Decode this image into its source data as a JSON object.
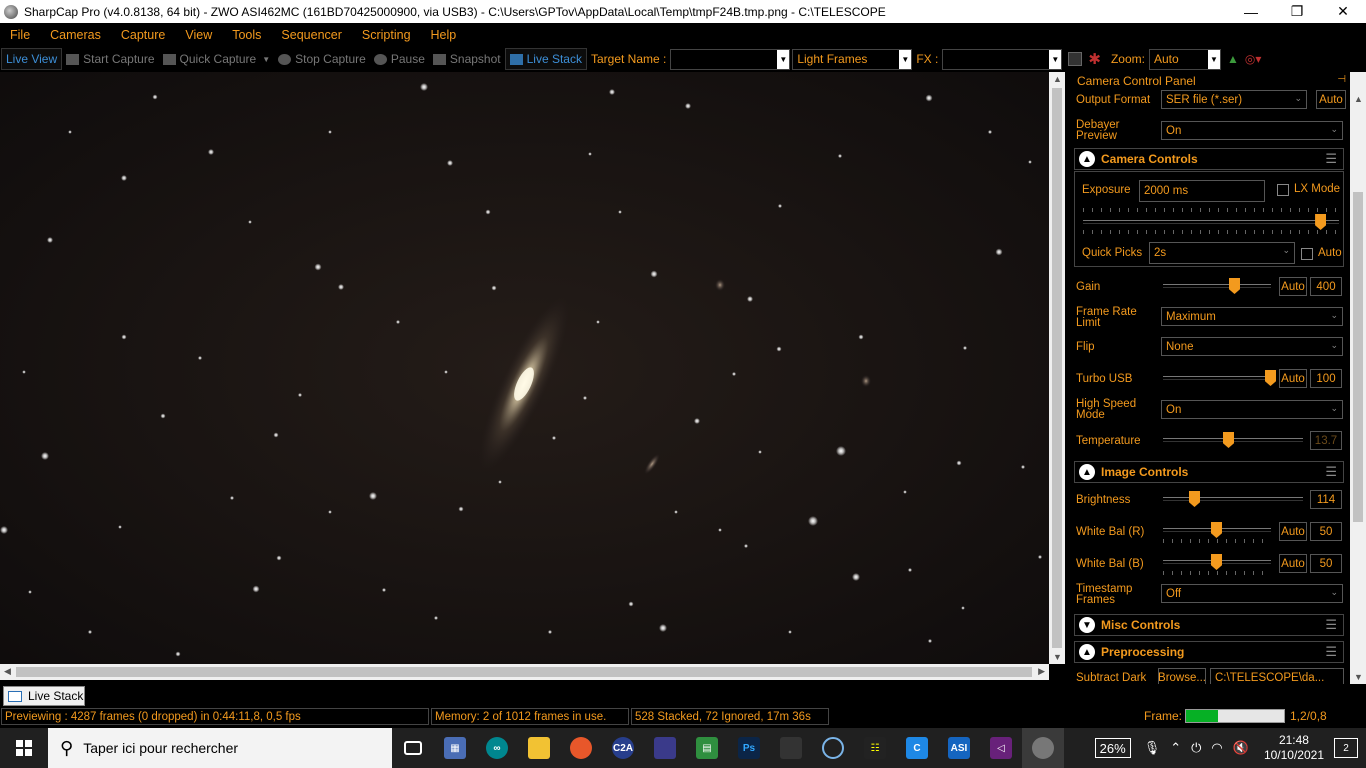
{
  "window": {
    "title": "SharpCap Pro (v4.0.8138, 64 bit) - ZWO ASI462MC (161BD70425000900, via USB3) - C:\\Users\\GPTov\\AppData\\Local\\Temp\\tmpF24B.tmp.png - C:\\TELESCOPE",
    "minimize": "—",
    "restore": "❐",
    "close": "✕"
  },
  "menu": [
    "File",
    "Cameras",
    "Capture",
    "View",
    "Tools",
    "Sequencer",
    "Scripting",
    "Help"
  ],
  "toolbar": {
    "live_view": "Live View",
    "start_capture": "Start Capture",
    "quick_capture": "Quick Capture",
    "stop_capture": "Stop Capture",
    "pause": "Pause",
    "snapshot": "Snapshot",
    "live_stack": "Live Stack",
    "target_name_label": "Target Name :",
    "target_name_value": "",
    "frame_type": "Light Frames",
    "fx_label": "FX :",
    "fx_value": "",
    "zoom_label": "Zoom:",
    "zoom_value": "Auto"
  },
  "panel": {
    "title": "Camera Control Panel",
    "output_format_label": "Output Format",
    "output_format_value": "SER file (*.ser)",
    "output_format_auto": "Auto",
    "debayer_label": "Debayer Preview",
    "debayer_value": "On",
    "camera_controls": {
      "title": "Camera Controls",
      "exposure_label": "Exposure",
      "exposure_value": "2000 ms",
      "lx_mode_label": "LX Mode",
      "exposure_slider": 0.93,
      "quick_picks_label": "Quick Picks",
      "quick_picks_value": "2s",
      "quick_picks_auto": "Auto",
      "gain_label": "Gain",
      "gain_auto": "Auto",
      "gain_value": "400",
      "frame_rate_label": "Frame Rate Limit",
      "frame_rate_value": "Maximum",
      "flip_label": "Flip",
      "flip_value": "None",
      "turbo_usb_label": "Turbo USB",
      "turbo_usb_auto": "Auto",
      "turbo_usb_value": "100",
      "high_speed_label": "High Speed Mode",
      "high_speed_value": "On",
      "temperature_label": "Temperature",
      "temperature_value": "13.7"
    },
    "image_controls": {
      "title": "Image Controls",
      "brightness_label": "Brightness",
      "brightness_value": "114",
      "wb_r_label": "White Bal (R)",
      "wb_r_auto": "Auto",
      "wb_r_value": "50",
      "wb_b_label": "White Bal (B)",
      "wb_b_auto": "Auto",
      "wb_b_value": "50",
      "timestamp_label": "Timestamp Frames",
      "timestamp_value": "Off"
    },
    "misc_controls": {
      "title": "Misc Controls"
    },
    "preprocessing": {
      "title": "Preprocessing",
      "subtract_dark_label": "Subtract Dark",
      "browse": "Browse...",
      "dark_path": "C:\\TELESCOPE\\da..."
    }
  },
  "tab": {
    "label": "Live Stack"
  },
  "status": {
    "previewing": "Previewing : 4287 frames (0 dropped) in 0:44:11,8, 0,5 fps",
    "memory": "Memory: 2 of 1012 frames in use.",
    "stacked": "528 Stacked, 72 Ignored, 17m 36s",
    "frame_label": "Frame:",
    "frame_progress": 0.33,
    "frame_value": "1,2/0,8"
  },
  "taskbar": {
    "search_placeholder": "Taper ici pour rechercher",
    "battery": "26%",
    "time": "21:48",
    "date": "10/10/2021",
    "notifications": "2",
    "icons": [
      "task-view-icon",
      "calculator-icon",
      "arduino-icon",
      "file-explorer-icon",
      "firefox-icon",
      "c2a-icon",
      "stellarium-icon",
      "spreadsheet-icon",
      "photoshop-icon",
      "astro-icon",
      "3d-viewer-icon",
      "app-grid-icon",
      "ccleaner-icon",
      "asi-icon",
      "visual-studio-icon",
      "sharpcap-icon"
    ]
  },
  "colors": {
    "accent": "#f39a1e",
    "active": "#3d8fd8",
    "progress": "#06b025"
  }
}
